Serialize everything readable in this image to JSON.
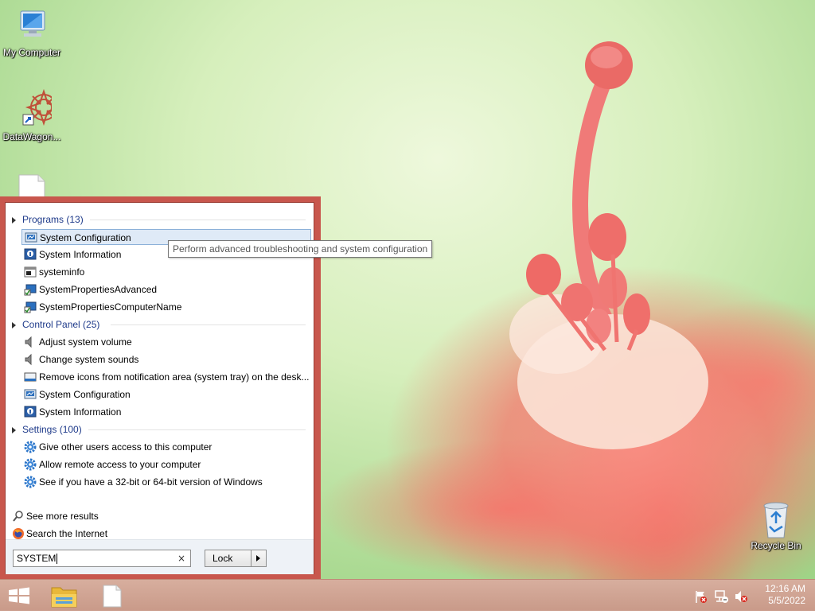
{
  "desktop": {
    "icons": [
      {
        "label": "My Computer",
        "icon": "computer-icon"
      },
      {
        "label": "DataWagon...",
        "icon": "datawagon-icon"
      },
      {
        "label": "",
        "icon": "file-icon"
      },
      {
        "label": "Recycle Bin",
        "icon": "recycle-bin-icon"
      }
    ]
  },
  "start_menu": {
    "groups": [
      {
        "header": "Programs (13)",
        "items": [
          {
            "label": "System Configuration",
            "icon": "msconfig-icon",
            "selected": true
          },
          {
            "label": "System Information",
            "icon": "system-info-icon"
          },
          {
            "label": "systeminfo",
            "icon": "console-icon"
          },
          {
            "label": "SystemPropertiesAdvanced",
            "icon": "system-properties-icon"
          },
          {
            "label": "SystemPropertiesComputerName",
            "icon": "system-properties-icon"
          }
        ]
      },
      {
        "header": "Control Panel (25)",
        "items": [
          {
            "label": "Adjust system volume",
            "icon": "speaker-icon"
          },
          {
            "label": "Change system sounds",
            "icon": "speaker-icon"
          },
          {
            "label": "Remove icons from notification area (system tray) on the desk...",
            "icon": "taskbar-icon"
          },
          {
            "label": "System Configuration",
            "icon": "msconfig-icon"
          },
          {
            "label": "System Information",
            "icon": "system-info-icon"
          }
        ]
      },
      {
        "header": "Settings (100)",
        "items": [
          {
            "label": "Give other users access to this computer",
            "icon": "settings-gear-icon"
          },
          {
            "label": "Allow remote access to your computer",
            "icon": "settings-gear-icon"
          },
          {
            "label": "See if you have a 32-bit or 64-bit version of Windows",
            "icon": "settings-gear-icon"
          }
        ]
      }
    ],
    "see_more": "See more results",
    "search_internet": "Search the Internet",
    "search": {
      "value": "SYSTEM",
      "clear_label": "×"
    },
    "lock_button": "Lock"
  },
  "tooltip": "Perform advanced troubleshooting and system configuration",
  "taskbar": {
    "buttons": [
      "start-button",
      "file-explorer-button",
      "document-button"
    ],
    "tray_icons": [
      "action-center-flag-icon",
      "network-icon",
      "volume-muted-icon"
    ],
    "clock": {
      "time": "12:16 AM",
      "date": "5/5/2022"
    }
  },
  "colors": {
    "menu_border": "#c8574d",
    "header_text": "#1e3a8a",
    "selection_bg": "#dfeaf7",
    "taskbar": "#cfa493"
  }
}
